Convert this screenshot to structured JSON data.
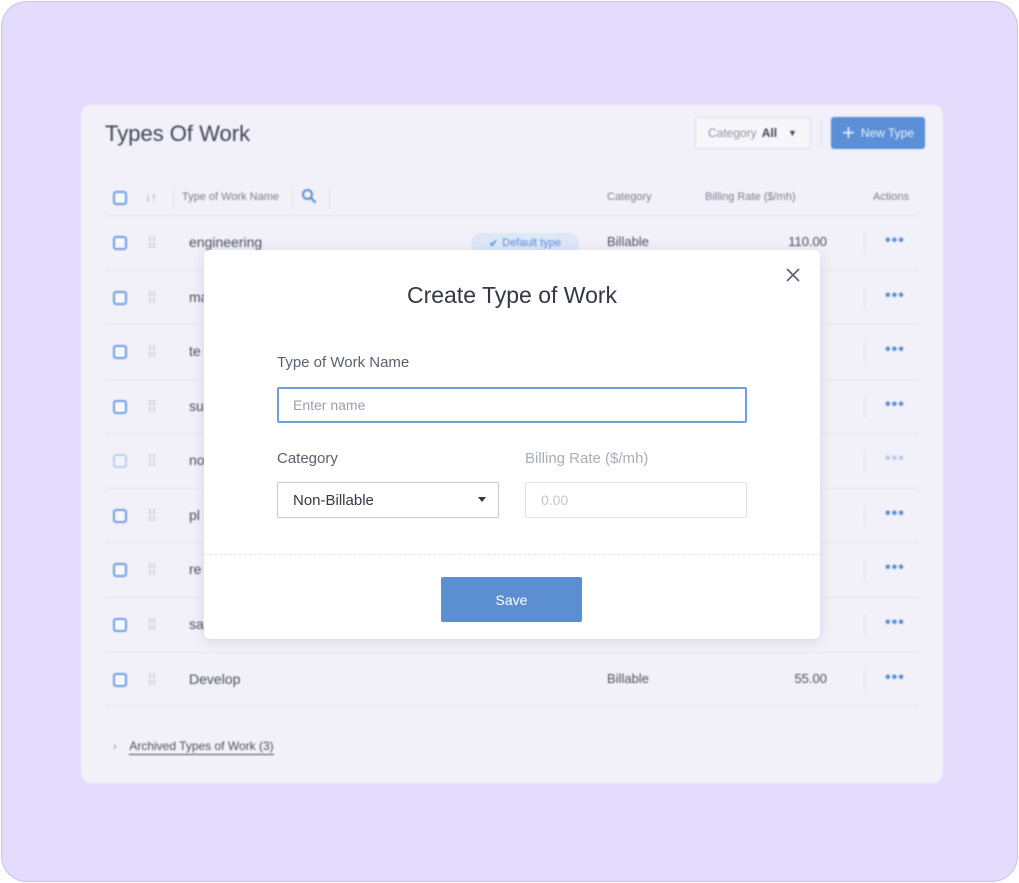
{
  "background": {
    "title": "Types Of Work",
    "filter": {
      "label": "Category",
      "value": "All"
    },
    "new_type_label": "New Type",
    "columns": {
      "name": "Type of Work Name",
      "category": "Category",
      "billing_rate": "Billing Rate ($/mh)",
      "actions": "Actions"
    },
    "rows": [
      {
        "name": "engineering",
        "badge": "Default type",
        "category": "Billable",
        "rate": "110.00"
      },
      {
        "name": "ma",
        "category": "",
        "rate": ""
      },
      {
        "name": "te",
        "category": "",
        "rate": ""
      },
      {
        "name": "su",
        "category": "",
        "rate": ""
      },
      {
        "name": "no",
        "category": "",
        "rate": ""
      },
      {
        "name": "pl",
        "category": "",
        "rate": ""
      },
      {
        "name": "re",
        "category": "",
        "rate": ""
      },
      {
        "name": "sa",
        "category": "",
        "rate": ""
      },
      {
        "name": "Develop",
        "category": "Billable",
        "rate": "55.00"
      }
    ],
    "actions_glyph": "•••",
    "archived_label": "Archived Types of Work (3)"
  },
  "modal": {
    "title": "Create Type of Work",
    "name_label": "Type of Work Name",
    "name_placeholder": "Enter name",
    "name_value": "",
    "category_label": "Category",
    "category_value": "Non-Billable",
    "rate_label": "Billing Rate ($/mh)",
    "rate_placeholder": "0.00",
    "save_label": "Save"
  },
  "colors": {
    "frame_bg": "#e4dcfc",
    "accent": "#5b8fd1",
    "input_focus_border": "#6f9fd6"
  }
}
